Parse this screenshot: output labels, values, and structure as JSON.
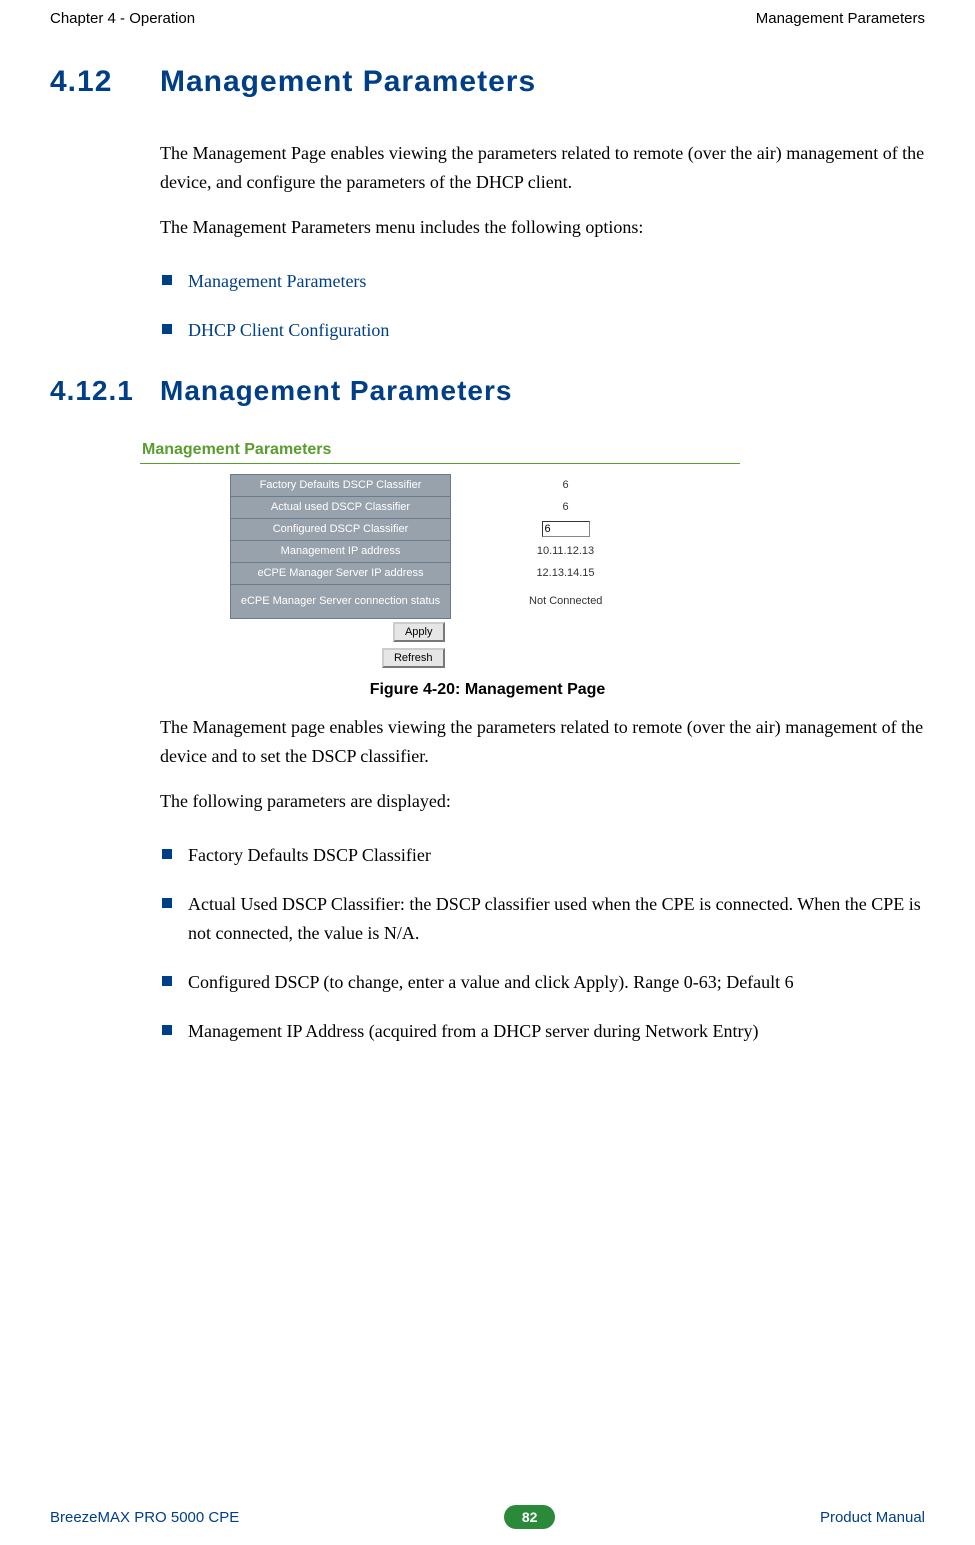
{
  "header": {
    "left": "Chapter 4 - Operation",
    "right": "Management Parameters"
  },
  "section": {
    "num": "4.12",
    "title": "Management Parameters",
    "intro1": "The Management Page enables viewing the parameters related to remote (over the air) management of the device, and configure the parameters of the DHCP client.",
    "intro2": "The Management Parameters menu includes the following options:",
    "links": [
      "Management Parameters",
      "DHCP Client Configuration"
    ]
  },
  "subsection": {
    "num": "4.12.1",
    "title": "Management Parameters"
  },
  "panel": {
    "title": "Management Parameters",
    "rows": [
      {
        "label": "Factory Defaults DSCP Classifier",
        "value": "6",
        "input": false
      },
      {
        "label": "Actual used DSCP Classifier",
        "value": "6",
        "input": false
      },
      {
        "label": "Configured DSCP Classifier",
        "value": "6",
        "input": true
      },
      {
        "label": "Management IP address",
        "value": "10.11.12.13",
        "input": false
      },
      {
        "label": "eCPE Manager Server IP address",
        "value": "12.13.14.15",
        "input": false
      },
      {
        "label": "eCPE Manager Server connection status",
        "value": "Not Connected",
        "input": false
      }
    ],
    "apply": "Apply",
    "refresh": "Refresh"
  },
  "figure_caption": "Figure 4-20: Management Page",
  "post": {
    "p1": "The Management page enables viewing the parameters related to remote (over the air) management of the device and to set the DSCP classifier.",
    "p2": "The following parameters are displayed:",
    "items": [
      "Factory Defaults DSCP Classifier",
      "Actual Used DSCP Classifier: the DSCP classifier used when the CPE is connected. When the CPE is not connected, the value is N/A.",
      "Configured DSCP (to change, enter a value and click Apply). Range 0-63; Default 6",
      "Management IP Address (acquired from a DHCP server during Network Entry)"
    ]
  },
  "footer": {
    "left": "BreezeMAX PRO 5000 CPE",
    "page": "82",
    "right": "Product Manual"
  }
}
